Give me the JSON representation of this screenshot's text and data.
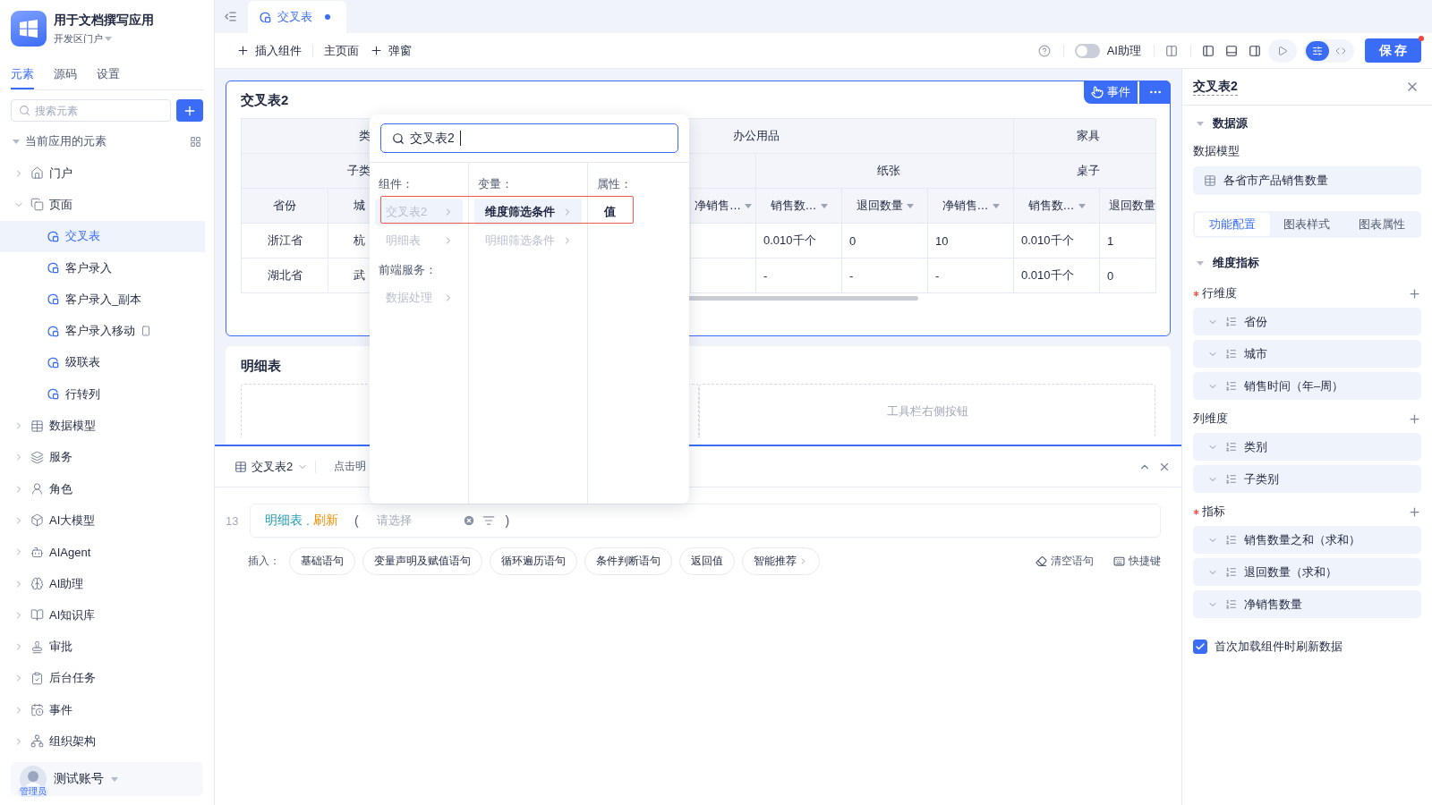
{
  "app": {
    "title": "用于文档撰写应用",
    "portal": "开发区门户"
  },
  "sidebar": {
    "tabs": [
      {
        "label": "元素",
        "selected": true
      },
      {
        "label": "源码",
        "selected": false
      },
      {
        "label": "设置",
        "selected": false
      }
    ],
    "search": {
      "placeholder": "搜索元素"
    },
    "tree_header": {
      "label": "当前应用的元素",
      "expanded": true
    },
    "items": [
      {
        "label": "门户",
        "kind": "portal",
        "expanded": false,
        "selected": false
      },
      {
        "label": "页面",
        "kind": "pages",
        "expanded": true,
        "selected": false,
        "children": [
          {
            "label": "交叉表",
            "mobile": false,
            "selected": true
          },
          {
            "label": "客户录入",
            "mobile": false,
            "selected": false
          },
          {
            "label": "客户录入_副本",
            "mobile": false,
            "selected": false
          },
          {
            "label": "客户录入移动",
            "mobile": true,
            "selected": false
          },
          {
            "label": "级联表",
            "mobile": false,
            "selected": false
          },
          {
            "label": "行转列",
            "mobile": false,
            "selected": false
          }
        ]
      },
      {
        "label": "数据模型",
        "kind": "model",
        "expanded": false,
        "selected": false
      },
      {
        "label": "服务",
        "kind": "service",
        "expanded": false,
        "selected": false
      },
      {
        "label": "角色",
        "kind": "role",
        "expanded": false,
        "selected": false
      },
      {
        "label": "AI大模型",
        "kind": "llm",
        "expanded": false,
        "selected": false
      },
      {
        "label": "AIAgent",
        "kind": "agent",
        "expanded": false,
        "selected": false
      },
      {
        "label": "AI助理",
        "kind": "assistant",
        "expanded": false,
        "selected": false
      },
      {
        "label": "AI知识库",
        "kind": "knowledge",
        "expanded": false,
        "selected": false
      },
      {
        "label": "审批",
        "kind": "approval",
        "expanded": false,
        "selected": false
      },
      {
        "label": "后台任务",
        "kind": "task",
        "expanded": false,
        "selected": false
      },
      {
        "label": "事件",
        "kind": "event",
        "expanded": false,
        "selected": false
      },
      {
        "label": "组织架构",
        "kind": "org",
        "expanded": false,
        "selected": false
      }
    ]
  },
  "account": {
    "name": "测试账号",
    "role": "管理员"
  },
  "editor_tabs": [
    {
      "label": "交叉表",
      "selected": true,
      "unsaved": true
    }
  ],
  "toolbar": {
    "actions": [
      {
        "label": "插入组件",
        "kind": "add"
      },
      {
        "label": "主页面",
        "kind": "plain"
      },
      {
        "label": "弹窗",
        "kind": "add"
      }
    ],
    "ai_toggle": {
      "label": "AI助理",
      "on": false
    },
    "modes": [
      {
        "kind": "settings",
        "selected": true
      },
      {
        "kind": "code",
        "selected": false
      }
    ],
    "save": {
      "label": "保 存",
      "unsaved": true
    }
  },
  "canvas": {
    "cross_table": {
      "title": "交叉表2",
      "selected": true,
      "event_button": "事件",
      "table": {
        "category_row": {
          "dimension": "类",
          "groups": [
            "办公用品",
            "家具"
          ]
        },
        "subcategory_row": {
          "dimension": "子类",
          "groups": [
            "纸张",
            "桌子"
          ]
        },
        "columns": [
          {
            "label": "省份",
            "sortable": false
          },
          {
            "label": "城"
          },
          {
            "label": "净销售…",
            "sortable": true
          },
          {
            "label": "销售数…",
            "sortable": true
          },
          {
            "label": "退回数量",
            "sortable": true
          },
          {
            "label": "净销售…",
            "sortable": true
          },
          {
            "label": "销售数…",
            "sortable": true
          },
          {
            "label": "退回数量"
          }
        ],
        "rows": [
          {
            "province": "浙江省",
            "city": "杭",
            "values": [
              "0.010千个",
              "0",
              "10",
              "0.010千个",
              "1"
            ]
          },
          {
            "province": "湖北省",
            "city": "武",
            "values": [
              "-",
              "-",
              "-",
              "0.010千个",
              "0"
            ]
          }
        ]
      }
    },
    "detail_table": {
      "title": "明细表",
      "toolbar_placeholder": "工具栏右侧按钮"
    }
  },
  "picker": {
    "query": "交叉表2",
    "highlight": true,
    "columns": [
      {
        "sections": [
          {
            "heading": "组件：",
            "items": [
              {
                "label": "交叉表2",
                "selected": true,
                "disabled": true,
                "has_children": true
              },
              {
                "label": "明细表",
                "selected": false,
                "disabled": true,
                "has_children": true
              }
            ]
          },
          {
            "heading": "前端服务：",
            "items": [
              {
                "label": "数据处理",
                "selected": false,
                "disabled": true,
                "has_children": true
              }
            ]
          }
        ]
      },
      {
        "sections": [
          {
            "heading": "变量：",
            "items": [
              {
                "label": "维度筛选条件",
                "selected": true,
                "disabled": false,
                "has_children": true
              },
              {
                "label": "明细筛选条件",
                "selected": false,
                "disabled": true,
                "has_children": true
              }
            ]
          }
        ]
      },
      {
        "sections": [
          {
            "heading": "属性：",
            "items": [
              {
                "label": "值",
                "selected": false,
                "disabled": false,
                "has_children": false
              }
            ]
          }
        ]
      }
    ]
  },
  "logic_panel": {
    "component": "交叉表2",
    "hint": "点击明",
    "line": {
      "number": "13",
      "object": "明细表",
      "dot": ".",
      "method": "刷新",
      "open": "(",
      "placeholder": "请选择",
      "close": ")"
    },
    "insert_label": "插入：",
    "snippets": [
      {
        "label": "基础语句",
        "kind": "plain"
      },
      {
        "label": "变量声明及赋值语句",
        "kind": "plain"
      },
      {
        "label": "循环遍历语句",
        "kind": "plain"
      },
      {
        "label": "条件判断语句",
        "kind": "plain"
      },
      {
        "label": "返回值",
        "kind": "plain"
      },
      {
        "label": "智能推荐",
        "kind": "menu"
      }
    ],
    "actions": [
      {
        "label": "清空语句",
        "kind": "clear"
      },
      {
        "label": "快捷键",
        "kind": "keyboard"
      }
    ]
  },
  "properties": {
    "title": "交叉表2",
    "data_source": {
      "label": "数据源",
      "expanded": true,
      "model_label": "数据模型",
      "model": "各省市产品销售数量"
    },
    "tabs": [
      {
        "label": "功能配置",
        "selected": true
      },
      {
        "label": "图表样式",
        "selected": false
      },
      {
        "label": "图表属性",
        "selected": false
      }
    ],
    "dimensions": {
      "label": "维度指标",
      "expanded": true,
      "groups": [
        {
          "label": "行维度",
          "required": true,
          "items": [
            "省份",
            "城市",
            "销售时间（年–周）"
          ]
        },
        {
          "label": "列维度",
          "required": false,
          "items": [
            "类别",
            "子类别"
          ]
        },
        {
          "label": "指标",
          "required": true,
          "items": [
            "销售数量之和（求和）",
            "退回数量（求和）",
            "净销售数量"
          ]
        }
      ]
    },
    "refresh_on_load": {
      "label": "首次加载组件时刷新数据",
      "checked": true
    }
  }
}
